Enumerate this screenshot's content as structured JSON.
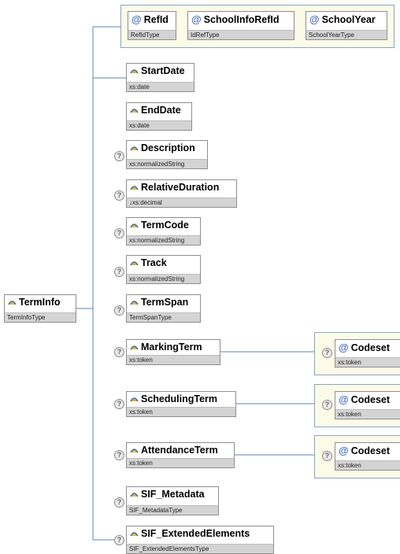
{
  "root": {
    "name": "TermInfo",
    "type": "TermInfoType"
  },
  "attributes": [
    {
      "name": "RefId",
      "type": "RefIdType"
    },
    {
      "name": "SchoolInfoRefId",
      "type": "IdRefType"
    },
    {
      "name": "SchoolYear",
      "type": "SchoolYearType"
    }
  ],
  "elements": [
    {
      "name": "StartDate",
      "type": "xs:date",
      "optional": false
    },
    {
      "name": "EndDate",
      "type": "xs:date",
      "optional": false
    },
    {
      "name": "Description",
      "type": "xs:normalizedString",
      "optional": true
    },
    {
      "name": "RelativeDuration",
      "type": "↓xs:decimal",
      "optional": true
    },
    {
      "name": "TermCode",
      "type": "xs:normalizedString",
      "optional": true
    },
    {
      "name": "Track",
      "type": "xs:normalizedString",
      "optional": true
    },
    {
      "name": "TermSpan",
      "type": "TermSpanType",
      "optional": true
    },
    {
      "name": "MarkingTerm",
      "type": "xs:token",
      "optional": true,
      "attribute": {
        "name": "Codeset",
        "type": "xs:token"
      }
    },
    {
      "name": "SchedulingTerm",
      "type": "xs:token",
      "optional": true,
      "attribute": {
        "name": "Codeset",
        "type": "xs:token"
      }
    },
    {
      "name": "AttendanceTerm",
      "type": "xs:token",
      "optional": true,
      "attribute": {
        "name": "Codeset",
        "type": "xs:token"
      }
    },
    {
      "name": "SIF_Metadata",
      "type": "SIF_MetadataType",
      "optional": true
    },
    {
      "name": "SIF_ExtendedElements",
      "type": "SIF_ExtendedElementsType",
      "optional": true
    }
  ],
  "optional_marker": "?",
  "attribute_marker": "@",
  "colors": {
    "line": "#5a85b5",
    "group_border": "#8aa6c2",
    "group_fill": "#fcfbe8",
    "type_bar": "#d4d4d4"
  }
}
